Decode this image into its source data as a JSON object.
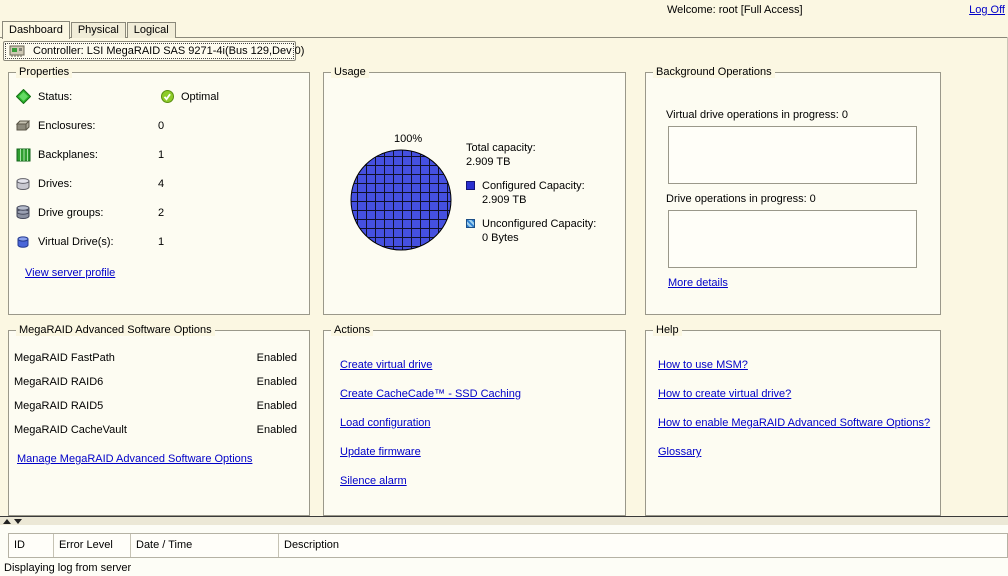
{
  "titlebar": {
    "welcome": "Welcome: root [Full Access]",
    "log_off": "Log Off"
  },
  "tabs": [
    {
      "label": "Dashboard",
      "active": true
    },
    {
      "label": "Physical",
      "active": false
    },
    {
      "label": "Logical",
      "active": false
    }
  ],
  "controller_bar": {
    "label": "Controller: LSI MegaRAID SAS 9271-4i(Bus 129,Dev 0)"
  },
  "panels": {
    "properties": {
      "title": "Properties",
      "rows": [
        {
          "icon": "status-icon",
          "label": "Status:",
          "value": "Optimal"
        },
        {
          "icon": "enclosures-icon",
          "label": "Enclosures:",
          "value": "0"
        },
        {
          "icon": "backplanes-icon",
          "label": "Backplanes:",
          "value": "1"
        },
        {
          "icon": "drives-icon",
          "label": "Drives:",
          "value": "4"
        },
        {
          "icon": "drive-groups-icon",
          "label": "Drive groups:",
          "value": "2"
        },
        {
          "icon": "virtual-drives-icon",
          "label": "Virtual Drive(s):",
          "value": "1"
        }
      ],
      "link": "View server profile"
    },
    "usage": {
      "title": "Usage",
      "pie_label": "100%",
      "legend": [
        {
          "label": "Total capacity:",
          "value": "2.909 TB"
        },
        {
          "label": "Configured Capacity:",
          "value": "2.909 TB"
        },
        {
          "label": "Unconfigured Capacity:",
          "value": "0 Bytes"
        }
      ]
    },
    "background_operations": {
      "title": "Background Operations",
      "vd_ops": "Virtual drive operations in progress: 0",
      "drive_ops": "Drive operations in progress: 0",
      "link": "More details"
    },
    "advanced_software": {
      "title": "MegaRAID Advanced Software Options",
      "rows": [
        {
          "label": "MegaRAID FastPath",
          "value": "Enabled"
        },
        {
          "label": "MegaRAID RAID6",
          "value": "Enabled"
        },
        {
          "label": "MegaRAID RAID5",
          "value": "Enabled"
        },
        {
          "label": "MegaRAID CacheVault",
          "value": "Enabled"
        }
      ],
      "link": "Manage MegaRAID Advanced Software Options"
    },
    "actions": {
      "title": "Actions",
      "links": [
        "Create virtual drive",
        "Create CacheCade™ - SSD Caching",
        "Load configuration",
        "Update firmware",
        "Silence alarm"
      ]
    },
    "help": {
      "title": "Help",
      "links": [
        "How to use MSM?",
        "How to create virtual drive?",
        "How to enable MegaRAID Advanced Software Options?",
        "Glossary"
      ]
    }
  },
  "log": {
    "columns": [
      "ID",
      "Error Level",
      "Date / Time",
      "Description"
    ],
    "status": "Displaying log from server"
  },
  "chart_data": {
    "type": "pie",
    "title": "Usage",
    "slices": [
      {
        "label": "Configured Capacity",
        "value_text": "2.909 TB",
        "percent": 100
      },
      {
        "label": "Unconfigured Capacity",
        "value_text": "0 Bytes",
        "percent": 0
      }
    ],
    "total": "2.909 TB",
    "data_label": "100%"
  },
  "colors": {
    "link_blue": "#0000c8",
    "pie_blue": "#4550e0",
    "configured_swatch": "#2a2fd0",
    "status_green": "#2db52d",
    "background_cream": "#fbf7e2"
  }
}
